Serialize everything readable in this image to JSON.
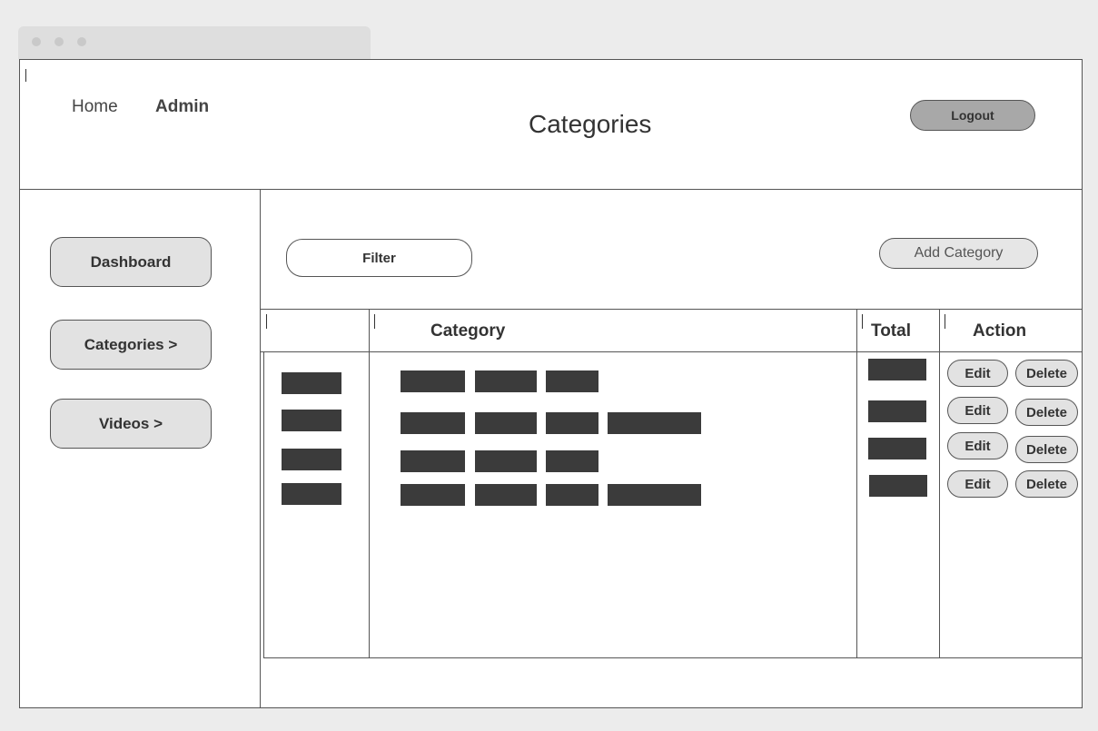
{
  "header": {
    "nav_home": "Home",
    "nav_admin": "Admin",
    "title": "Categories",
    "logout_label": "Logout"
  },
  "sidebar": {
    "items": [
      {
        "label": "Dashboard"
      },
      {
        "label": "Categories >"
      },
      {
        "label": "Videos >"
      }
    ]
  },
  "toolbar": {
    "filter_label": "Filter",
    "add_label": "Add Category"
  },
  "table": {
    "columns": [
      "",
      "Category",
      "Total",
      "Action"
    ],
    "rows": [
      {
        "edit_label": "Edit",
        "delete_label": "Delete"
      },
      {
        "edit_label": "Edit",
        "delete_label": "Delete"
      },
      {
        "edit_label": "Edit",
        "delete_label": "Delete"
      },
      {
        "edit_label": "Edit",
        "delete_label": "Delete"
      }
    ]
  },
  "colors": {
    "placeholder_block": "#3b3b3b",
    "logout_bg": "#a8a8a8",
    "button_bg": "#e2e2e2",
    "border": "#555555"
  }
}
